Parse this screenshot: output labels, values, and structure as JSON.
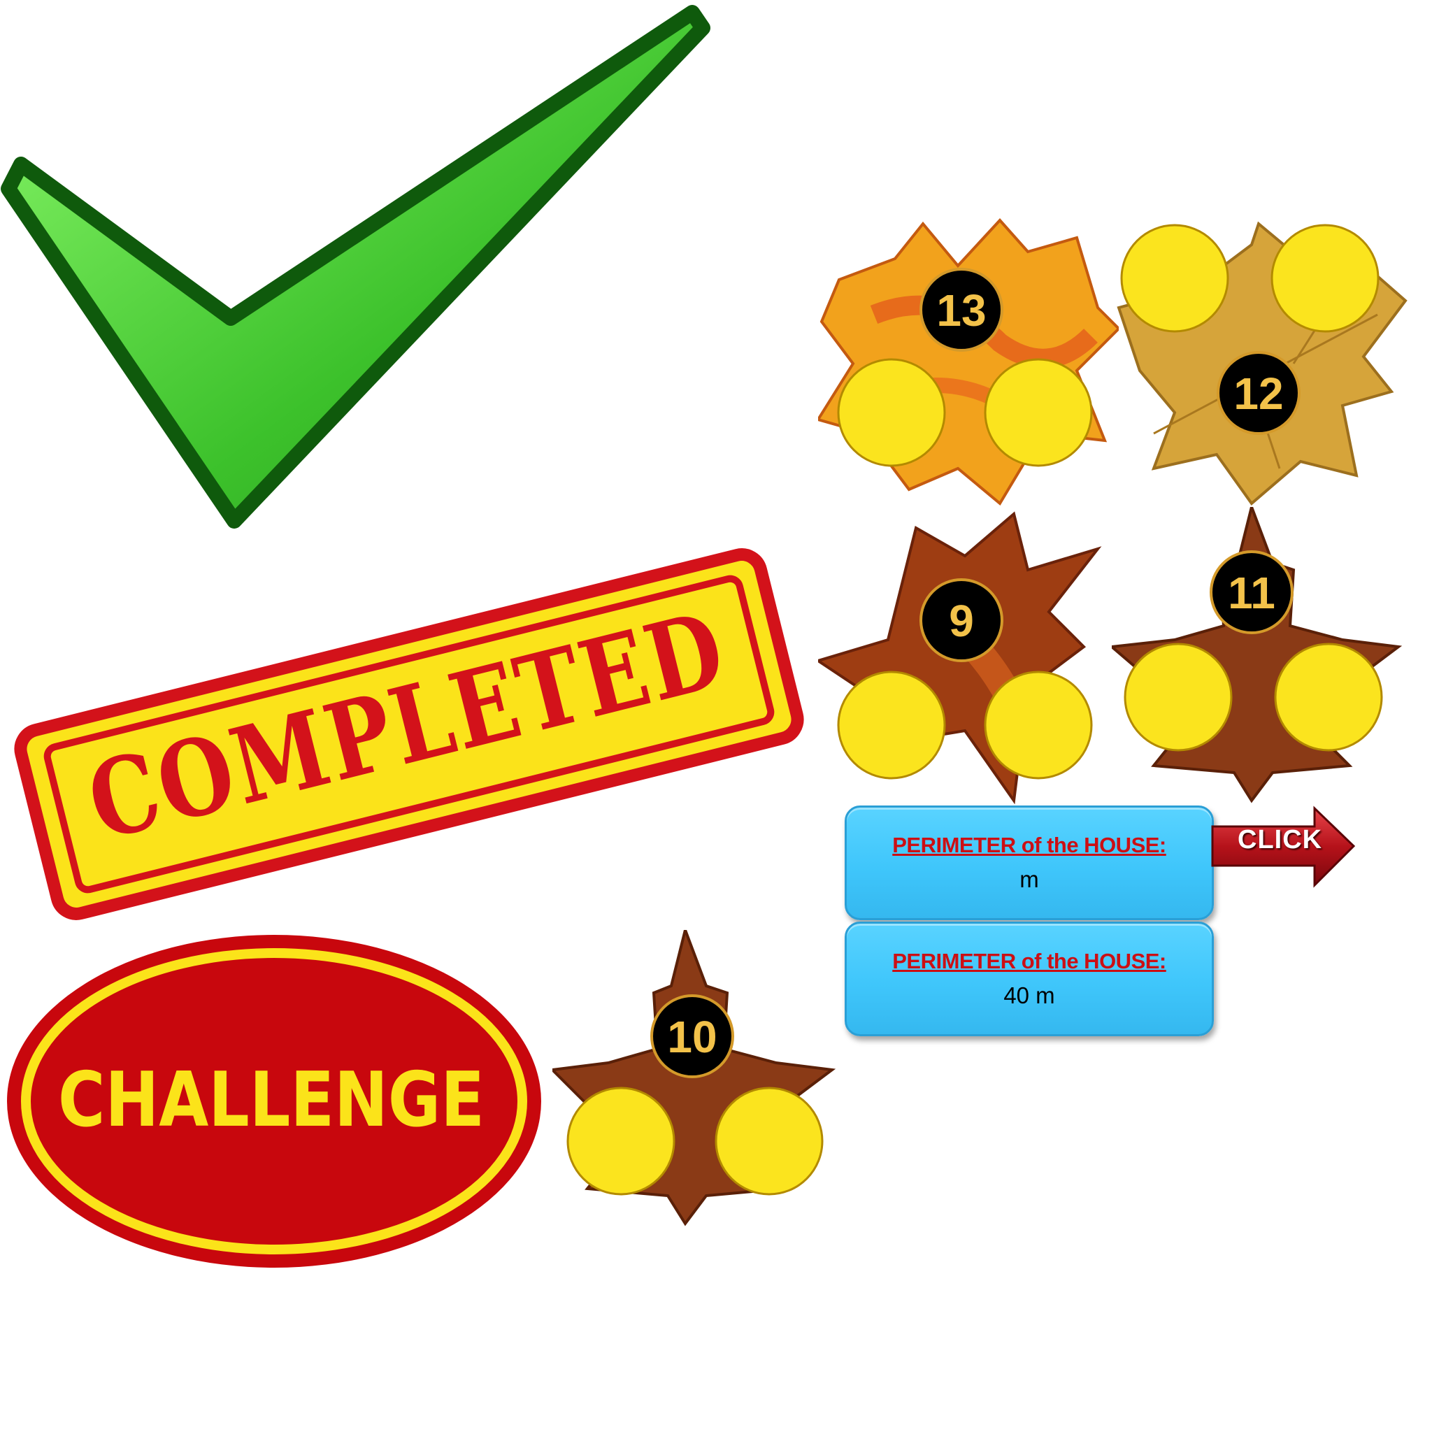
{
  "stamps": {
    "completed": "COMPLETED",
    "challenge": "CHALLENGE"
  },
  "leaves": [
    {
      "number": "13"
    },
    {
      "number": "12"
    },
    {
      "number": "9"
    },
    {
      "number": "11"
    },
    {
      "number": "10"
    }
  ],
  "answers": {
    "top": {
      "label": "PERIMETER of the HOUSE:",
      "value": "m"
    },
    "bottom": {
      "label": "PERIMETER of the HOUSE:",
      "value": "40 m"
    }
  },
  "click_button": {
    "label": "CLICK"
  },
  "colors": {
    "check_green": "#3fbf2c",
    "stamp_red": "#d3121a",
    "stamp_yellow": "#fbe31a",
    "coin_yellow": "#fbe41e",
    "answer_blue": "#4fcdfd",
    "answer_label_red": "#cc0f14"
  }
}
